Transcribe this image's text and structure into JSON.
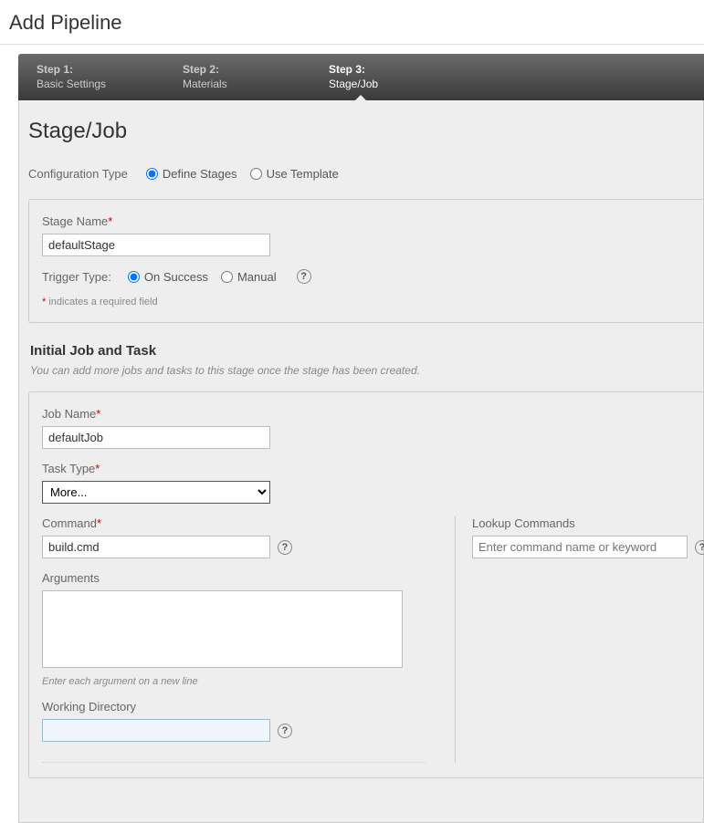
{
  "header": {
    "title": "Add Pipeline"
  },
  "wizard": {
    "steps": [
      {
        "title": "Step 1:",
        "label": "Basic Settings"
      },
      {
        "title": "Step 2:",
        "label": "Materials"
      },
      {
        "title": "Step 3:",
        "label": "Stage/Job"
      }
    ]
  },
  "main": {
    "heading": "Stage/Job",
    "config_type_label": "Configuration Type",
    "config_type_opts": {
      "define": "Define Stages",
      "template": "Use Template"
    },
    "stage_name_label": "Stage Name",
    "stage_name_value": "defaultStage",
    "trigger_label": "Trigger Type:",
    "trigger_opts": {
      "success": "On Success",
      "manual": "Manual"
    },
    "required_note": " indicates a required field",
    "initial_heading": "Initial Job and Task",
    "initial_desc": "You can add more jobs and tasks to this stage once the stage has been created.",
    "job_name_label": "Job Name",
    "job_name_value": "defaultJob",
    "task_type_label": "Task Type",
    "task_type_value": "More...",
    "command_label": "Command",
    "command_value": "build.cmd",
    "arguments_label": "Arguments",
    "arguments_value": "",
    "arguments_hint": "Enter each argument on a new line",
    "working_dir_label": "Working Directory",
    "working_dir_value": "",
    "lookup_label": "Lookup Commands",
    "lookup_placeholder": "Enter command name or keyword"
  }
}
